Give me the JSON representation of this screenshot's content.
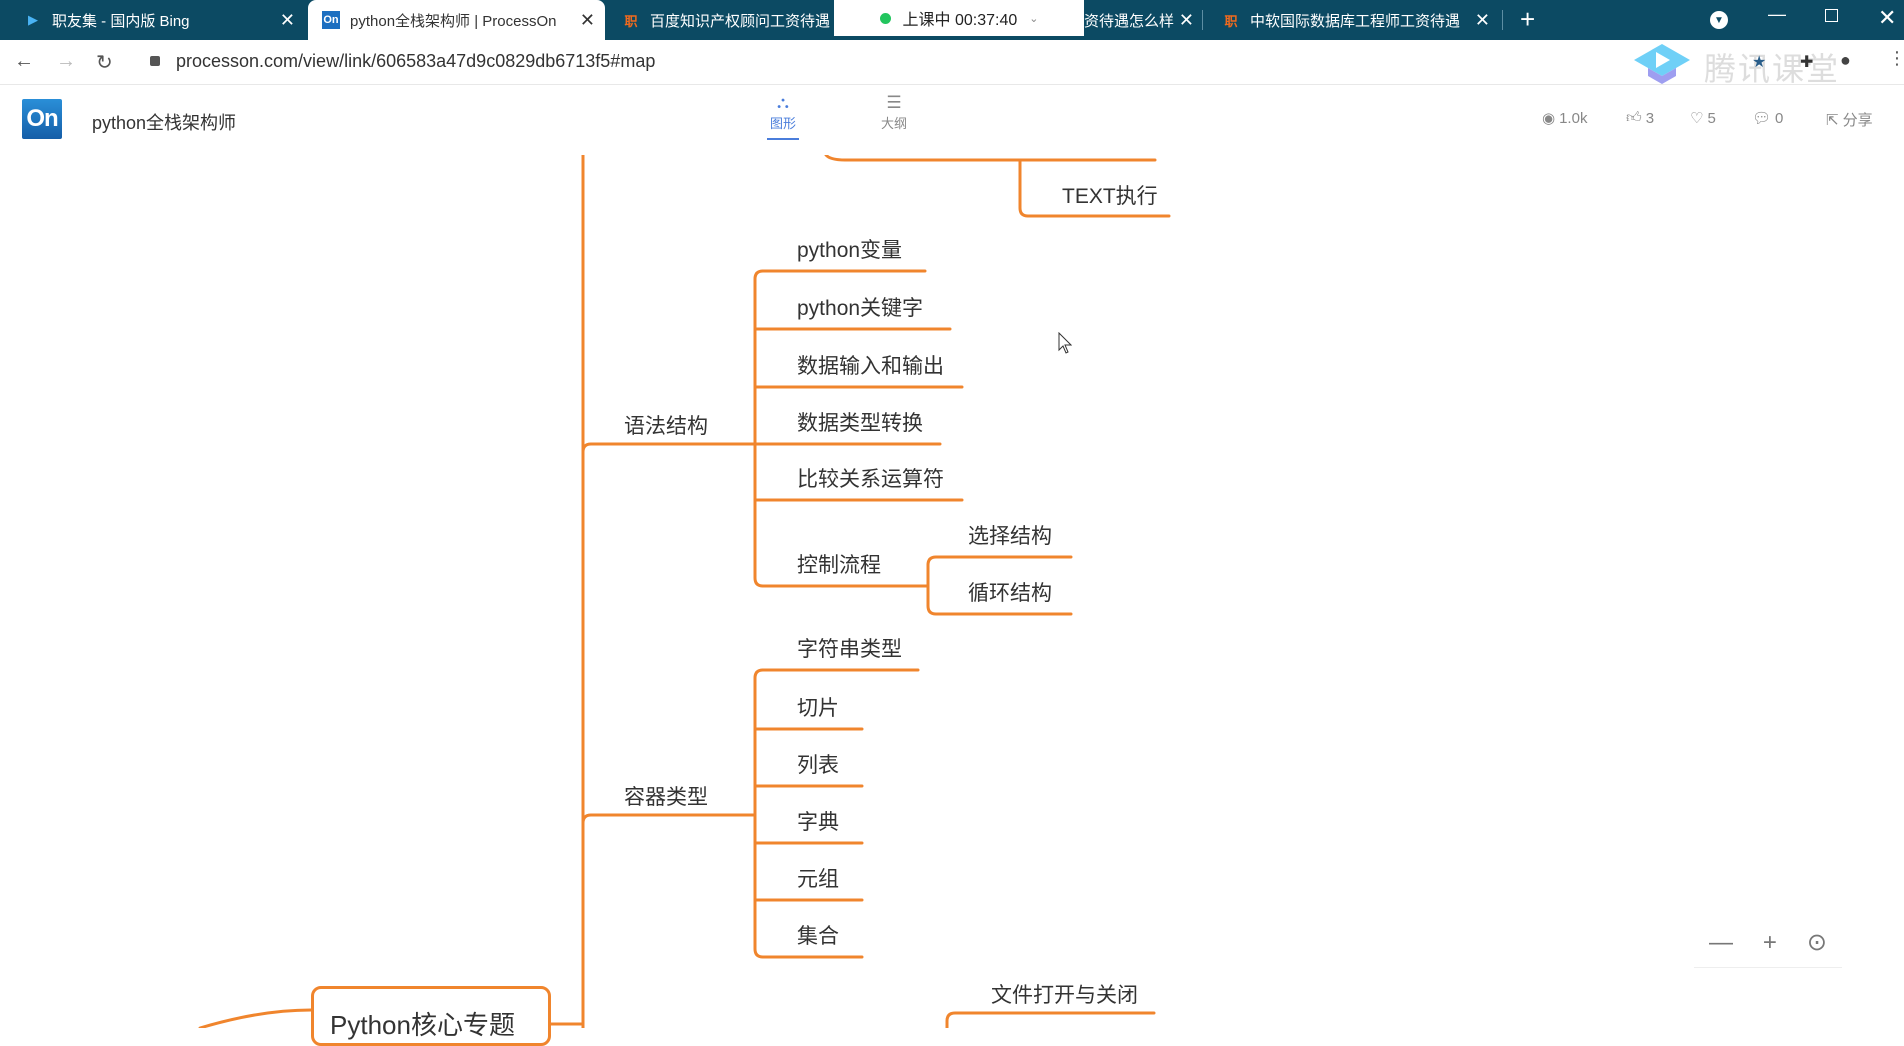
{
  "browser": {
    "tabs": [
      {
        "label": "职友集 - 国内版 Bing",
        "icon": "bing-icon",
        "active": false
      },
      {
        "label": "python全栈架构师 | ProcessOn",
        "icon": "processon-icon",
        "active": true
      },
      {
        "label": "百度知识产权顾问工资待遇",
        "icon": "zhiyouji-icon",
        "active": false
      },
      {
        "label": "资待遇怎么样",
        "icon": "",
        "active": false
      },
      {
        "label": "中软国际数据库工程师工资待遇",
        "icon": "zhiyouji-icon",
        "active": false
      }
    ],
    "tab_icon_glyph": "职",
    "class_status": "上课中 00:37:40",
    "url": "processon.com/view/link/606583a47d9c0829db6713f5#map",
    "overlay_watermark": "腾讯课堂"
  },
  "app": {
    "logo_text": "On",
    "doc_title": "python全栈架构师",
    "view_tabs": [
      {
        "label": "图形",
        "active": true
      },
      {
        "label": "大纲",
        "active": false
      }
    ],
    "stats": {
      "views": "1.0k",
      "likes": "3",
      "favorites": "5",
      "comments": "0",
      "share": "分享"
    }
  },
  "mindmap": {
    "accent_color": "#f0852d",
    "root": "Python核心专题",
    "text_exec": "TEXT执行",
    "branches": [
      {
        "label": "语法结构",
        "children": [
          "python变量",
          "python关键字",
          "数据输入和输出",
          "数据类型转换",
          "比较关系运算符",
          "控制流程"
        ],
        "control_flow_children": [
          "选择结构",
          "循环结构"
        ]
      },
      {
        "label": "容器类型",
        "children": [
          "字符串类型",
          "切片",
          "列表",
          "字典",
          "元组",
          "集合"
        ]
      }
    ],
    "file_ops": "文件打开与关闭"
  },
  "zoom_controls": {
    "minus": "—",
    "plus": "+",
    "locate": "⊙"
  }
}
